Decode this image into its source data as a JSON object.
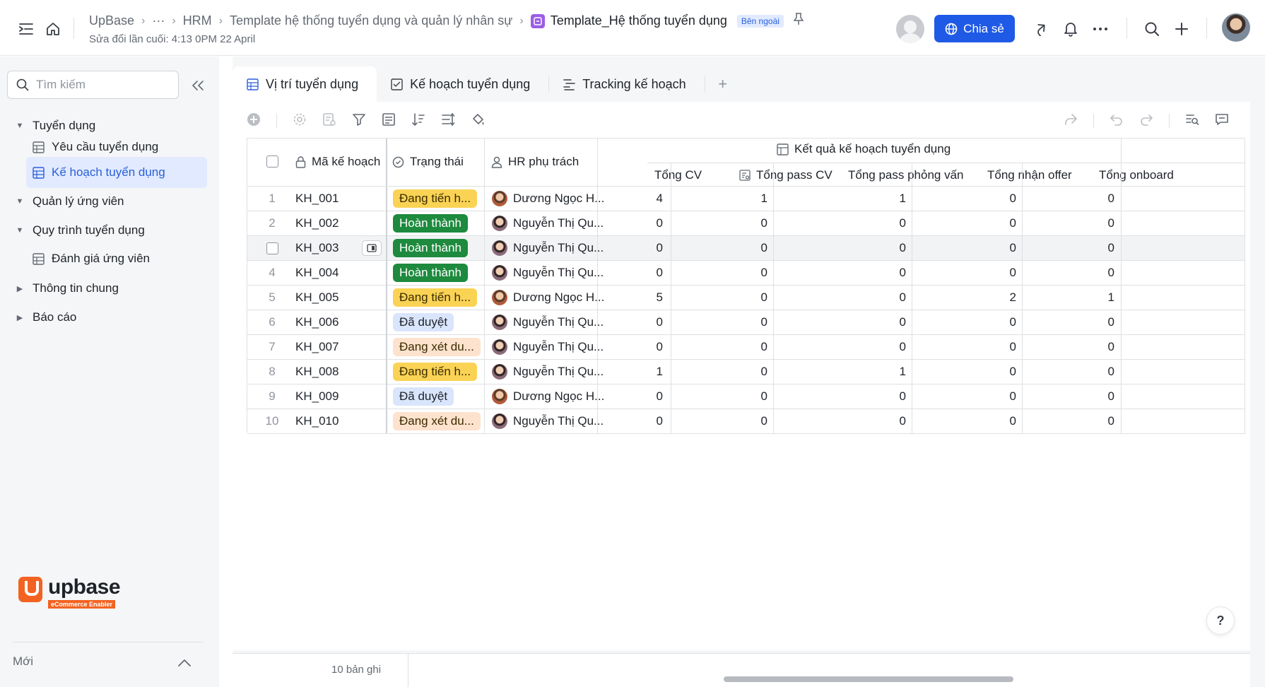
{
  "breadcrumb": {
    "items": [
      "UpBase",
      "···",
      "HRM",
      "Template hệ thống tuyển dụng và quản lý nhân sự"
    ],
    "current": "Template_Hệ thống tuyển dụng",
    "badge": "Bên ngoài",
    "last_modified": "Sửa đổi lần cuối: 4:13 0PM 22 April"
  },
  "header": {
    "share_label": "Chia sẻ",
    "accent_color": "#1f5ae6"
  },
  "sidebar": {
    "search_placeholder": "Tìm kiếm",
    "groups": [
      {
        "label": "Tuyển dụng",
        "expanded": true
      },
      {
        "label": "Quản lý ứng viên",
        "expanded": true
      },
      {
        "label": "Quy trình tuyển dụng",
        "expanded": true
      },
      {
        "label": "Thông tin chung",
        "expanded": false
      },
      {
        "label": "Báo cáo",
        "expanded": false
      }
    ],
    "items": [
      {
        "label": "Yêu cầu tuyển dụng",
        "active": false
      },
      {
        "label": "Kế hoạch tuyển dụng",
        "active": true
      },
      {
        "label": "Đánh giá ứng viên",
        "active": false
      }
    ],
    "logo_word": "upbase",
    "logo_tagline": "eCommerce Enabler",
    "footer_label": "Mới"
  },
  "tabs": [
    {
      "label": "Vị trí tuyển dụng",
      "active": true,
      "icon": "grid-icon"
    },
    {
      "label": "Kế hoạch tuyển dụng",
      "active": false,
      "icon": "checklist-icon"
    },
    {
      "label": "Tracking kế hoạch",
      "active": false,
      "icon": "gantt-icon"
    }
  ],
  "table": {
    "headers": {
      "code": "Mã kế hoạch",
      "status": "Trạng thái",
      "hr": "HR phụ trách",
      "group": "Kết quả kế hoạch tuyển dụng",
      "total_cv": "Tổng CV",
      "pass_cv": "Tổng pass CV",
      "pass_interview": "Tổng pass phỏng vấn",
      "offer": "Tổng nhận offer",
      "onboard": "Tổng onboard"
    },
    "rows": [
      {
        "n": "1",
        "code": "KH_001",
        "status": "Đang tiến h...",
        "status_type": "progress",
        "hr": "Dương Ngọc H...",
        "av": "a1",
        "cv": "4",
        "pcv": "1",
        "piv": "1",
        "offer": "0",
        "onb": "0"
      },
      {
        "n": "2",
        "code": "KH_002",
        "status": "Hoàn thành",
        "status_type": "done",
        "hr": "Nguyễn Thị Qu...",
        "av": "a2",
        "cv": "0",
        "pcv": "0",
        "piv": "0",
        "offer": "0",
        "onb": "0"
      },
      {
        "n": "3",
        "code": "KH_003",
        "status": "Hoàn thành",
        "status_type": "done",
        "hr": "Nguyễn Thị Qu...",
        "av": "a2",
        "cv": "0",
        "pcv": "0",
        "piv": "0",
        "offer": "0",
        "onb": "0"
      },
      {
        "n": "4",
        "code": "KH_004",
        "status": "Hoàn thành",
        "status_type": "done",
        "hr": "Nguyễn Thị Qu...",
        "av": "a2",
        "cv": "0",
        "pcv": "0",
        "piv": "0",
        "offer": "0",
        "onb": "0"
      },
      {
        "n": "5",
        "code": "KH_005",
        "status": "Đang tiến h...",
        "status_type": "progress",
        "hr": "Dương Ngọc H...",
        "av": "a1",
        "cv": "5",
        "pcv": "0",
        "piv": "0",
        "offer": "2",
        "onb": "1"
      },
      {
        "n": "6",
        "code": "KH_006",
        "status": "Đã duyệt",
        "status_type": "approved",
        "hr": "Nguyễn Thị Qu...",
        "av": "a2",
        "cv": "0",
        "pcv": "0",
        "piv": "0",
        "offer": "0",
        "onb": "0"
      },
      {
        "n": "7",
        "code": "KH_007",
        "status": "Đang xét du...",
        "status_type": "review",
        "hr": "Nguyễn Thị Qu...",
        "av": "a2",
        "cv": "0",
        "pcv": "0",
        "piv": "0",
        "offer": "0",
        "onb": "0"
      },
      {
        "n": "8",
        "code": "KH_008",
        "status": "Đang tiến h...",
        "status_type": "progress",
        "hr": "Nguyễn Thị Qu...",
        "av": "a2",
        "cv": "1",
        "pcv": "0",
        "piv": "1",
        "offer": "0",
        "onb": "0"
      },
      {
        "n": "9",
        "code": "KH_009",
        "status": "Đã duyệt",
        "status_type": "approved",
        "hr": "Dương Ngọc H...",
        "av": "a1",
        "cv": "0",
        "pcv": "0",
        "piv": "0",
        "offer": "0",
        "onb": "0"
      },
      {
        "n": "10",
        "code": "KH_010",
        "status": "Đang xét du...",
        "status_type": "review",
        "hr": "Nguyễn Thị Qu...",
        "av": "a2",
        "cv": "0",
        "pcv": "0",
        "piv": "0",
        "offer": "0",
        "onb": "0"
      }
    ],
    "hovered_row": 3,
    "record_count": "10 bản ghi"
  },
  "status_colors": {
    "progress": "#fad355",
    "done": "#1e8a3e",
    "approved": "#d9e5fc",
    "review": "#fde2cd"
  }
}
